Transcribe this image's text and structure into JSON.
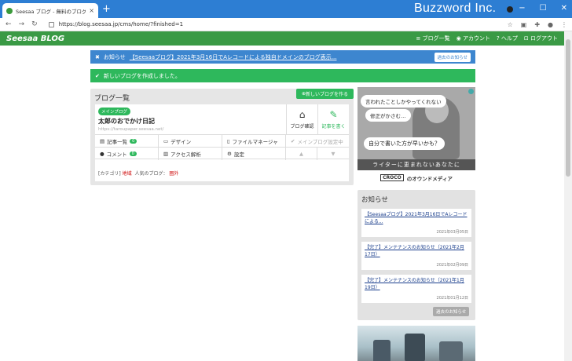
{
  "browser": {
    "tab_title": "Seesaa ブログ - 無料のブログ(blog) ...",
    "tab_close": "×",
    "new_tab": "+",
    "url": "https://blog.seesaa.jp/cms/home/?finished=1",
    "brand": "Buzzword Inc."
  },
  "site": {
    "logo": "Seesaa BLOG",
    "menu": [
      "ブログ一覧",
      "アカウント",
      "ヘルプ",
      "ログアウト"
    ]
  },
  "notice": {
    "label": "お知らせ",
    "link": "【Seesaaブログ】2021年3月16日でAレコードによる独自ドメインのブログ表示...",
    "past_button": "過去のお知らせ"
  },
  "success": {
    "message": "新しいブログを作成しました。"
  },
  "blog_list": {
    "title": "ブログ一覧",
    "new_button": "新しいブログを作る",
    "badge": "メインブログ",
    "blog_name": "太郎のおでかけ日記",
    "blog_url": "https://taroupaper.seesaa.net/",
    "view_button": "ブログ確認",
    "write_button": "記事を書く",
    "row1": {
      "articles": "記事一覧",
      "articles_count": "0",
      "design": "デザイン",
      "file_manager": "ファイルマネージャ",
      "main_blog": "メインブログ設定中"
    },
    "row2": {
      "comments": "コメント",
      "comments_count": "0",
      "access": "アクセス解析",
      "settings": "設定"
    },
    "category_label": "[カテゴリ]",
    "category_value": "地域",
    "popular_label": "人気のブログ：",
    "popular_value": "圏外"
  },
  "ad": {
    "line1": "言われたことしかやってくれない",
    "line2": "修正がかさむ…",
    "line3": "自分で書いた方が早いかも？",
    "strip": "ライターに恵まれないあなたに",
    "brand_box": "CROCO",
    "brand_text": "のオウンドメディア"
  },
  "news": {
    "title": "お知らせ",
    "items": [
      {
        "text": "【Seesaaブログ】2021年3月16日でAレコードによる...",
        "date": "2021年03月05日"
      },
      {
        "text": "【完了】メンテナンスのお知らせ（2021年2月17日）",
        "date": "2021年02月09日"
      },
      {
        "text": "【完了】メンテナンスのお知らせ（2021年1月19日）",
        "date": "2021年01月12日"
      }
    ],
    "past_button": "過去のお知らせ"
  }
}
